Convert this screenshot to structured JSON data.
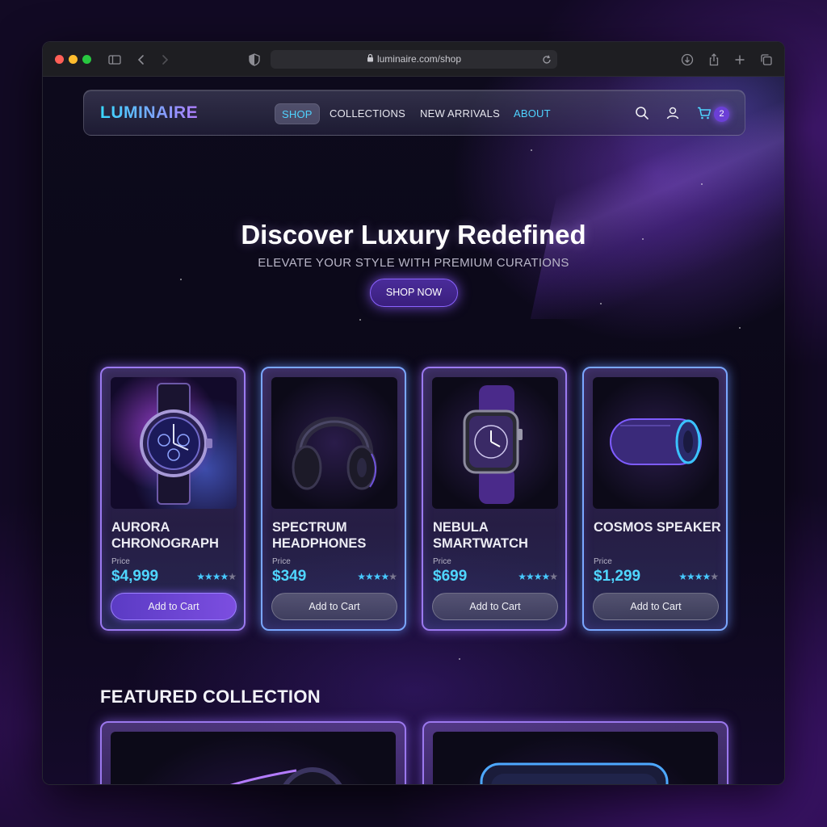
{
  "browser": {
    "url": "luminaire.com/shop"
  },
  "nav": {
    "logo": "LUMINAIRE",
    "links": [
      "SHOP",
      "COLLECTIONS",
      "NEW ARRIVALS",
      "ABOUT"
    ],
    "active_link": "SHOP",
    "cart_count": "2"
  },
  "hero": {
    "title": "Discover Luxury Redefined",
    "subtitle": "ELEVATE YOUR STYLE WITH PREMIUM CURATIONS",
    "cta": "SHOP NOW"
  },
  "products": [
    {
      "name": "AURORA CHRONOGRAPH",
      "price_label": "Price",
      "price": "$4,999",
      "rating": 4,
      "button": "Add to Cart",
      "image": "watch"
    },
    {
      "name": "SPECTRUM HEADPHONES",
      "price_label": "Price",
      "price": "$349",
      "rating": 4,
      "button": "Add to Cart",
      "image": "headphones"
    },
    {
      "name": "NEBULA SMARTWATCH",
      "price_label": "Price",
      "price": "$699",
      "rating": 4.5,
      "button": "Add to Cart",
      "image": "smartwatch"
    },
    {
      "name": "COSMOS SPEAKER",
      "price_label": "Price",
      "price": "$1,299",
      "rating": 4,
      "button": "Add to Cart",
      "image": "speaker"
    }
  ],
  "featured": {
    "title": "FEATURED COLLECTION",
    "items": [
      "speaker",
      "speaker"
    ]
  },
  "colors": {
    "accent_cyan": "#4fd6ff",
    "accent_purple": "#8a63ff",
    "background": "#0b0818"
  }
}
